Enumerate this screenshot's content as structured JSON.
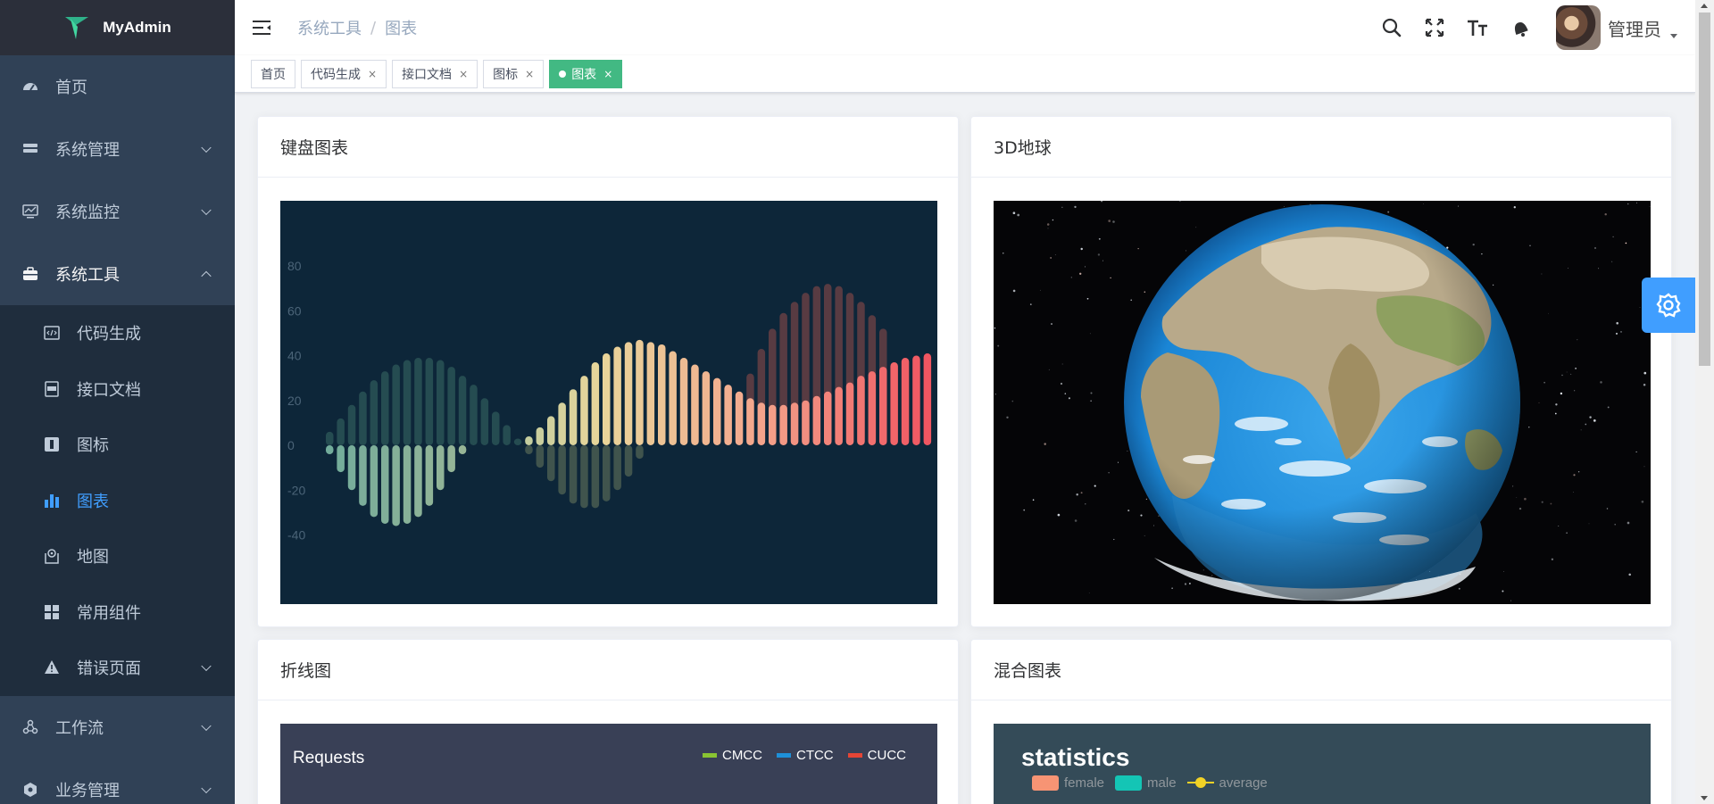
{
  "app": {
    "name": "MyAdmin",
    "colors": {
      "sidebar": "#304156",
      "submenu": "#1f2d3d",
      "accent": "#409eff",
      "tag_active": "#42b983"
    }
  },
  "sidebar": {
    "items": [
      {
        "label": "首页",
        "icon": "dashboard-icon"
      },
      {
        "label": "系统管理",
        "icon": "system-icon"
      },
      {
        "label": "系统监控",
        "icon": "monitor-icon"
      },
      {
        "label": "系统工具",
        "icon": "toolbox-icon"
      },
      {
        "label": "工作流",
        "icon": "workflow-icon"
      },
      {
        "label": "业务管理",
        "icon": "business-icon"
      }
    ],
    "sub_items": [
      {
        "label": "代码生成",
        "icon": "code-icon"
      },
      {
        "label": "接口文档",
        "icon": "swagger-icon"
      },
      {
        "label": "图标",
        "icon": "icon-icon"
      },
      {
        "label": "图表",
        "icon": "chart-icon",
        "active": true
      },
      {
        "label": "地图",
        "icon": "map-icon"
      },
      {
        "label": "常用组件",
        "icon": "component-icon"
      },
      {
        "label": "错误页面",
        "icon": "error-icon"
      }
    ]
  },
  "navbar": {
    "breadcrumb": [
      "系统工具",
      "/",
      "图表"
    ],
    "user_name": "管理员"
  },
  "tags": [
    {
      "label": "首页",
      "closable": false
    },
    {
      "label": "代码生成",
      "closable": true
    },
    {
      "label": "接口文档",
      "closable": true
    },
    {
      "label": "图标",
      "closable": true
    },
    {
      "label": "图表",
      "closable": true,
      "active": true
    }
  ],
  "cards": {
    "keyboard": {
      "title": "键盘图表"
    },
    "globe": {
      "title": "3D地球"
    },
    "line": {
      "title": "折线图"
    },
    "mixed": {
      "title": "混合图表"
    }
  },
  "chart_data": [
    {
      "type": "bar",
      "ylim": [
        -40,
        80
      ],
      "ytick_labels": [
        "80",
        "60",
        "40",
        "20",
        "0",
        "-20",
        "-40"
      ],
      "series": [
        {
          "values": [
            6,
            12,
            18,
            24,
            29,
            33,
            36,
            38,
            39,
            39,
            38,
            35,
            31,
            27,
            21,
            15,
            9,
            3,
            4,
            8,
            13,
            19,
            25,
            31,
            37,
            41,
            44,
            46,
            47,
            46,
            45,
            42,
            39,
            36,
            33,
            30,
            27,
            24,
            21,
            19,
            18,
            18,
            19,
            20,
            22,
            24,
            26,
            28,
            31,
            33,
            35,
            37,
            39,
            40,
            41
          ]
        },
        {
          "values": [
            -4,
            -12,
            -20,
            -27,
            -32,
            -35,
            -36,
            -35,
            -32,
            -27,
            -20,
            -12,
            -4,
            0,
            0,
            0,
            0,
            0,
            -4,
            -10,
            -16,
            -22,
            -26,
            -28,
            -28,
            -25,
            -20,
            -14,
            -6,
            0,
            0,
            0,
            0,
            0,
            0,
            0,
            0,
            0,
            0,
            0,
            0,
            0,
            0,
            0,
            0,
            0,
            0,
            0,
            0,
            0,
            0,
            0,
            0,
            0,
            0
          ]
        },
        {
          "values": [
            0,
            0,
            0,
            0,
            0,
            0,
            0,
            0,
            0,
            0,
            0,
            0,
            0,
            0,
            0,
            0,
            0,
            0,
            0,
            0,
            0,
            0,
            0,
            0,
            0,
            0,
            0,
            0,
            0,
            0,
            0,
            0,
            0,
            0,
            0,
            0,
            0,
            0,
            32,
            43,
            52,
            59,
            64,
            68,
            71,
            72,
            71,
            68,
            64,
            58,
            52,
            0,
            0,
            0,
            0
          ]
        }
      ]
    },
    {
      "type": "line",
      "title": "Requests",
      "series": [
        {
          "name": "CMCC",
          "color": "#89c432"
        },
        {
          "name": "CTCC",
          "color": "#1e90d8"
        },
        {
          "name": "CUCC",
          "color": "#e54535"
        }
      ]
    },
    {
      "type": "bar",
      "title": "statistics",
      "series": [
        {
          "name": "female",
          "color": "#f79474"
        },
        {
          "name": "male",
          "color": "#14c5b5"
        },
        {
          "name": "average",
          "color": "#f2d226"
        }
      ]
    }
  ]
}
